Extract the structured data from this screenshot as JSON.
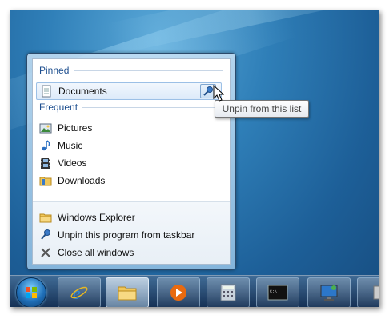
{
  "jump_list": {
    "pinned_header": "Pinned",
    "pinned_items": [
      {
        "label": "Documents",
        "icon": "document-icon"
      }
    ],
    "frequent_header": "Frequent",
    "frequent_items": [
      {
        "label": "Pictures",
        "icon": "pictures-icon"
      },
      {
        "label": "Music",
        "icon": "music-note-icon"
      },
      {
        "label": "Videos",
        "icon": "film-strip-icon"
      },
      {
        "label": "Downloads",
        "icon": "downloads-folder-icon"
      }
    ],
    "tasks": [
      {
        "label": "Windows Explorer",
        "icon": "folder-icon"
      },
      {
        "label": "Unpin this program from taskbar",
        "icon": "pushpin-icon"
      },
      {
        "label": "Close all windows",
        "icon": "close-x-icon"
      }
    ]
  },
  "tooltip": {
    "text": "Unpin from this list"
  },
  "taskbar": {
    "items": [
      {
        "name": "start-button",
        "icon": "windows-orb-icon"
      },
      {
        "name": "internet-explorer",
        "icon": "ie-icon"
      },
      {
        "name": "windows-explorer",
        "icon": "explorer-folder-icon",
        "active": true
      },
      {
        "name": "media-player",
        "icon": "media-player-icon"
      },
      {
        "name": "calculator",
        "icon": "calculator-icon"
      },
      {
        "name": "command-prompt",
        "icon": "cmd-icon",
        "label": "C:\\_"
      },
      {
        "name": "remote-desktop",
        "icon": "monitor-icon"
      },
      {
        "name": "more",
        "icon": "partial-icon"
      }
    ]
  },
  "colors": {
    "header_text": "#1e4f8f",
    "desktop_blue": "#2f7fb8",
    "selected_bg": "#dceaf9"
  }
}
